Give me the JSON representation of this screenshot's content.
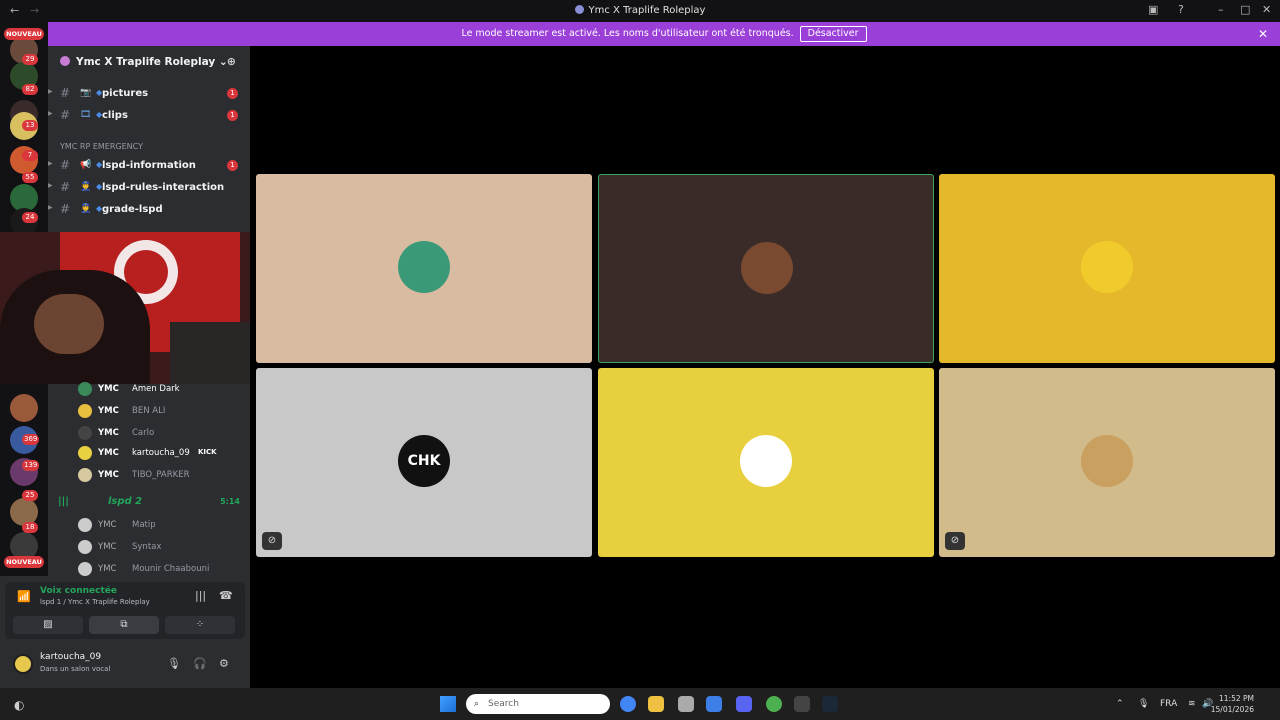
{
  "window": {
    "title": "Ymc X Traplife Roleplay",
    "back_icon": "arrow-left-icon",
    "forward_icon": "arrow-right-icon"
  },
  "banner": {
    "text": "Le mode streamer est activé. Les noms d'utilisateur ont été tronqués.",
    "button": "Désactiver",
    "close": "✕",
    "color": "#9b3fd9"
  },
  "guilds": {
    "nouveau": "NOUVEAU",
    "badges": [
      "29",
      "82",
      "13",
      "7",
      "55",
      "24",
      "369",
      "139",
      "25",
      "18"
    ]
  },
  "server": {
    "name": "Ymc X Traplife Roleplay"
  },
  "channels": [
    {
      "emoji": "📷",
      "name": "pictures",
      "badge": "1"
    },
    {
      "emoji": "🎞",
      "name": "clips",
      "badge": "1"
    },
    {
      "emoji": "📢",
      "name": "lspd-information",
      "badge": "1"
    },
    {
      "emoji": "👮",
      "name": "lspd-rules-interaction",
      "badge": ""
    },
    {
      "emoji": "👮",
      "name": "grade-lspd",
      "badge": ""
    }
  ],
  "category": "YMC RP EMERGENCY",
  "voice_members": [
    {
      "tag": "YMC",
      "name": "Amen Dark",
      "bold": true
    },
    {
      "tag": "YMC",
      "name": "BEN ALI",
      "bold": false
    },
    {
      "tag": "YMC",
      "name": "Carlo",
      "bold": false
    },
    {
      "tag": "YMC",
      "name": "kartoucha_09",
      "bold": true,
      "extra": "KICK"
    },
    {
      "tag": "YMC",
      "name": "TIBO_PARKER",
      "bold": false
    }
  ],
  "voice_channel2": {
    "name": "lspd 2",
    "time": "5:14"
  },
  "voice_members2": [
    {
      "tag": "YMC",
      "name": "Matip"
    },
    {
      "tag": "YMC",
      "name": "Syntax"
    },
    {
      "tag": "YMC",
      "name": "Mounir Chaabouni"
    }
  ],
  "voice_panel": {
    "status": "Voix connectée",
    "channel": "lspd 1 / Ymc X Traplife Roleplay"
  },
  "user_panel": {
    "name": "kartoucha_09",
    "status": "Dans un salon vocal"
  },
  "tiles": [
    {
      "bg": "#d8bba1",
      "avatar": "#3a9a78",
      "muted": false,
      "active": false
    },
    {
      "bg": "#3a2b28",
      "avatar": "#7a4a30",
      "muted": false,
      "active": true
    },
    {
      "bg": "#e5b82b",
      "avatar": "#f1cb2c",
      "muted": false,
      "active": false
    },
    {
      "bg": "#c8c8c8",
      "avatar": "#111111",
      "muted": true,
      "active": false,
      "label": "CHK"
    },
    {
      "bg": "#e8cf3d",
      "avatar": "#ffffff",
      "muted": false,
      "active": false
    },
    {
      "bg": "#d2bb8a",
      "avatar": "#c9a060",
      "muted": true,
      "active": false
    }
  ],
  "taskbar": {
    "search": "Search",
    "lang": "FRA",
    "time": "11:52 PM",
    "date": "15/01/2026"
  }
}
